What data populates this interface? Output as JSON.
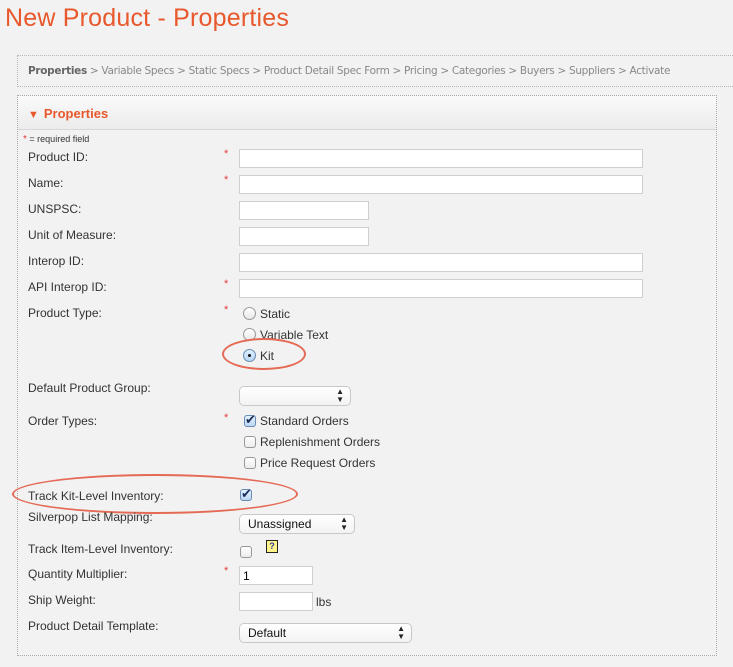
{
  "page": {
    "title": "New Product - Properties"
  },
  "breadcrumb": [
    {
      "label": "Properties",
      "active": true
    },
    {
      "label": "Variable Specs"
    },
    {
      "label": "Static Specs"
    },
    {
      "label": "Product Detail Spec Form"
    },
    {
      "label": "Pricing"
    },
    {
      "label": "Categories"
    },
    {
      "label": "Buyers"
    },
    {
      "label": "Suppliers"
    },
    {
      "label": "Activate"
    }
  ],
  "breadcrumb_separator": ">",
  "panel": {
    "title": "Properties",
    "collapse_icon": "▼",
    "required_star": "*",
    "required_note": "= required field"
  },
  "fields": {
    "product_id": {
      "label": "Product ID:",
      "value": "",
      "required": true
    },
    "name": {
      "label": "Name:",
      "value": "",
      "required": true
    },
    "unspsc": {
      "label": "UNSPSC:",
      "value": ""
    },
    "unit_of_measure": {
      "label": "Unit of Measure:",
      "value": ""
    },
    "interop_id": {
      "label": "Interop ID:",
      "value": ""
    },
    "api_interop_id": {
      "label": "API Interop ID:",
      "value": "",
      "required": true
    },
    "product_type": {
      "label": "Product Type:",
      "required": true,
      "options": [
        "Static",
        "Variable Text",
        "Kit"
      ],
      "selected": "Kit"
    },
    "default_product_group": {
      "label": "Default Product Group:",
      "value": ""
    },
    "order_types": {
      "label": "Order Types:",
      "required": true,
      "options": [
        {
          "label": "Standard Orders",
          "checked": true
        },
        {
          "label": "Replenishment Orders",
          "checked": false
        },
        {
          "label": "Price Request Orders",
          "checked": false
        }
      ]
    },
    "track_kit_level_inventory": {
      "label": "Track Kit-Level Inventory:",
      "checked": true
    },
    "silverpop_list_mapping": {
      "label": "Silverpop List Mapping:",
      "value": "Unassigned"
    },
    "track_item_level_inventory": {
      "label": "Track Item-Level Inventory:",
      "checked": false,
      "help_icon": "?"
    },
    "quantity_multiplier": {
      "label": "Quantity Multiplier:",
      "value": "1",
      "required": true
    },
    "ship_weight": {
      "label": "Ship Weight:",
      "value": "",
      "unit": "lbs"
    },
    "product_detail_template": {
      "label": "Product Detail Template:",
      "value": "Default"
    }
  },
  "star": "*",
  "select_arrows": "▲▼",
  "annotation_color": "#e56a55",
  "accent_color": "#e8582c"
}
